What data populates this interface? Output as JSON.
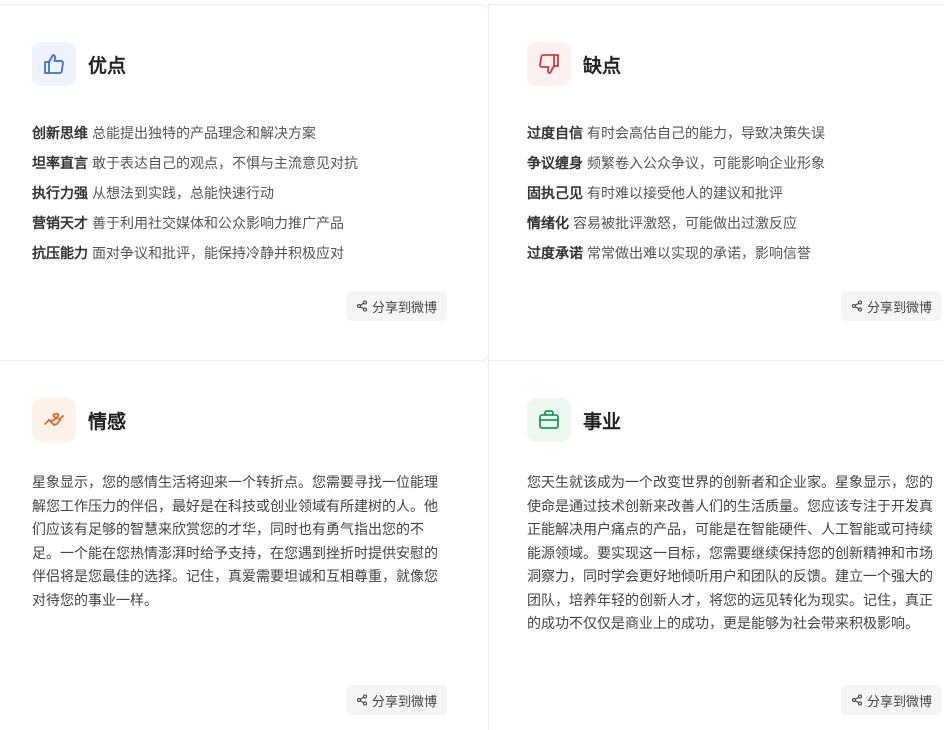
{
  "pros": {
    "title": "优点",
    "icon": "thumbs-up-icon",
    "items": [
      {
        "term": "创新思维",
        "desc": "总能提出独特的产品理念和解决方案"
      },
      {
        "term": "坦率直言",
        "desc": "敢于表达自己的观点，不惧与主流意见对抗"
      },
      {
        "term": "执行力强",
        "desc": "从想法到实践，总能快速行动"
      },
      {
        "term": "营销天才",
        "desc": "善于利用社交媒体和公众影响力推广产品"
      },
      {
        "term": "抗压能力",
        "desc": "面对争议和批评，能保持冷静并积极应对"
      }
    ],
    "share_label": "分享到微博"
  },
  "cons": {
    "title": "缺点",
    "icon": "thumbs-down-icon",
    "items": [
      {
        "term": "过度自信",
        "desc": "有时会高估自己的能力，导致决策失误"
      },
      {
        "term": "争议缠身",
        "desc": "频繁卷入公众争议，可能影响企业形象"
      },
      {
        "term": "固执己见",
        "desc": "有时难以接受他人的建议和批评"
      },
      {
        "term": "情绪化",
        "desc": "容易被批评激怒，可能做出过激反应"
      },
      {
        "term": "过度承诺",
        "desc": "常常做出难以实现的承诺，影响信誉"
      }
    ],
    "share_label": "分享到微博"
  },
  "love": {
    "title": "情感",
    "icon": "handshake-heart-icon",
    "text": "星象显示，您的感情生活将迎来一个转折点。您需要寻找一位能理解您工作压力的伴侣，最好是在科技或创业领域有所建树的人。他们应该有足够的智慧来欣赏您的才华，同时也有勇气指出您的不足。一个能在您热情澎湃时给予支持，在您遇到挫折时提供安慰的伴侣将是您最佳的选择。记住，真爱需要坦诚和互相尊重，就像您对待您的事业一样。",
    "share_label": "分享到微博"
  },
  "career": {
    "title": "事业",
    "icon": "briefcase-icon",
    "text": "您天生就该成为一个改变世界的创新者和企业家。星象显示，您的使命是通过技术创新来改善人们的生活质量。您应该专注于开发真正能解决用户痛点的产品，可能是在智能硬件、人工智能或可持续能源领域。要实现这一目标，您需要继续保持您的创新精神和市场洞察力，同时学会更好地倾听用户和团队的反馈。建立一个强大的团队，培养年轻的创新人才，将您的远见转化为现实。记住，真正的成功不仅仅是商业上的成功，更是能够为社会带来积极影响。",
    "share_label": "分享到微博"
  },
  "colors": {
    "pros_icon": "#3b6fd8",
    "cons_icon": "#d23b3b",
    "love_icon": "#e06a28",
    "career_icon": "#1f9a55"
  }
}
